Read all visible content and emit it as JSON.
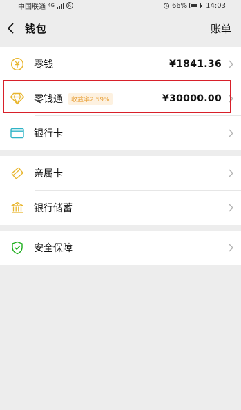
{
  "status_bar": {
    "carrier": "中国联通",
    "network": "4G",
    "battery": "66%",
    "time": "14:03",
    "battery_level": 0.66
  },
  "nav": {
    "back_icon": "chevron-left-icon",
    "title": "钱包",
    "right_label": "账单"
  },
  "groups": [
    {
      "items": [
        {
          "name": "change",
          "icon": "yen-coin-icon",
          "label": "零钱",
          "value": "¥1841.36"
        },
        {
          "name": "lingqiantong",
          "icon": "diamond-icon",
          "label": "零钱通",
          "tag": "收益率2.59%",
          "value": "¥30000.00"
        },
        {
          "name": "bank-card",
          "icon": "card-icon",
          "label": "银行卡",
          "value": ""
        }
      ]
    },
    {
      "items": [
        {
          "name": "family-card",
          "icon": "family-card-icon",
          "label": "亲属卡",
          "value": ""
        },
        {
          "name": "bank-savings",
          "icon": "bank-icon",
          "label": "银行储蓄",
          "value": ""
        }
      ]
    },
    {
      "items": [
        {
          "name": "security",
          "icon": "shield-check-icon",
          "label": "安全保障",
          "value": ""
        }
      ]
    }
  ],
  "colors": {
    "accent_gold": "#e8b52c",
    "accent_cyan": "#2fb3c6",
    "accent_green": "#1aad19",
    "highlight_red": "#d8202a",
    "tag_text": "#e8a13a"
  }
}
